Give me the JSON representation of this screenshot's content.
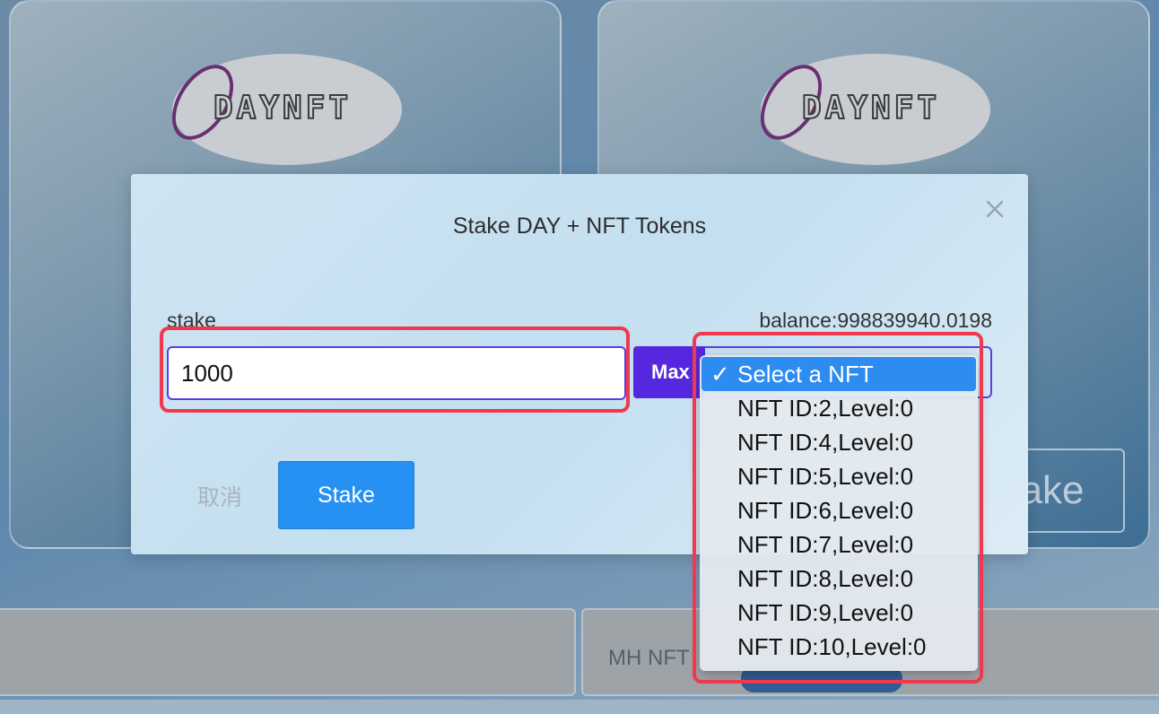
{
  "background": {
    "left_card": {
      "logo_text": "DAYNFT"
    },
    "right_card": {
      "logo_text": "DAYNFT",
      "stake_button_label": "Stake"
    },
    "bottom_right_panel": {
      "label": "MH NFT"
    }
  },
  "modal": {
    "title": "Stake DAY + NFT Tokens",
    "stake_label": "stake",
    "balance_label": "balance:998839940.0198",
    "amount_input": {
      "value": "1000"
    },
    "max_label": "Max",
    "nft_select": {
      "selected": "Select a NFT",
      "options": [
        "Select a NFT",
        "NFT ID:2,Level:0",
        "NFT ID:4,Level:0",
        "NFT ID:5,Level:0",
        "NFT ID:6,Level:0",
        "NFT ID:7,Level:0",
        "NFT ID:8,Level:0",
        "NFT ID:9,Level:0",
        "NFT ID:10,Level:0"
      ]
    },
    "cancel_label": "取消",
    "stake_button_label": "Stake"
  },
  "colors": {
    "accent_purple": "#5528e0",
    "primary_blue": "#2691f3",
    "highlight_red": "#f0384e"
  },
  "icons": {
    "close": "close-icon",
    "check": "checkmark-icon"
  }
}
